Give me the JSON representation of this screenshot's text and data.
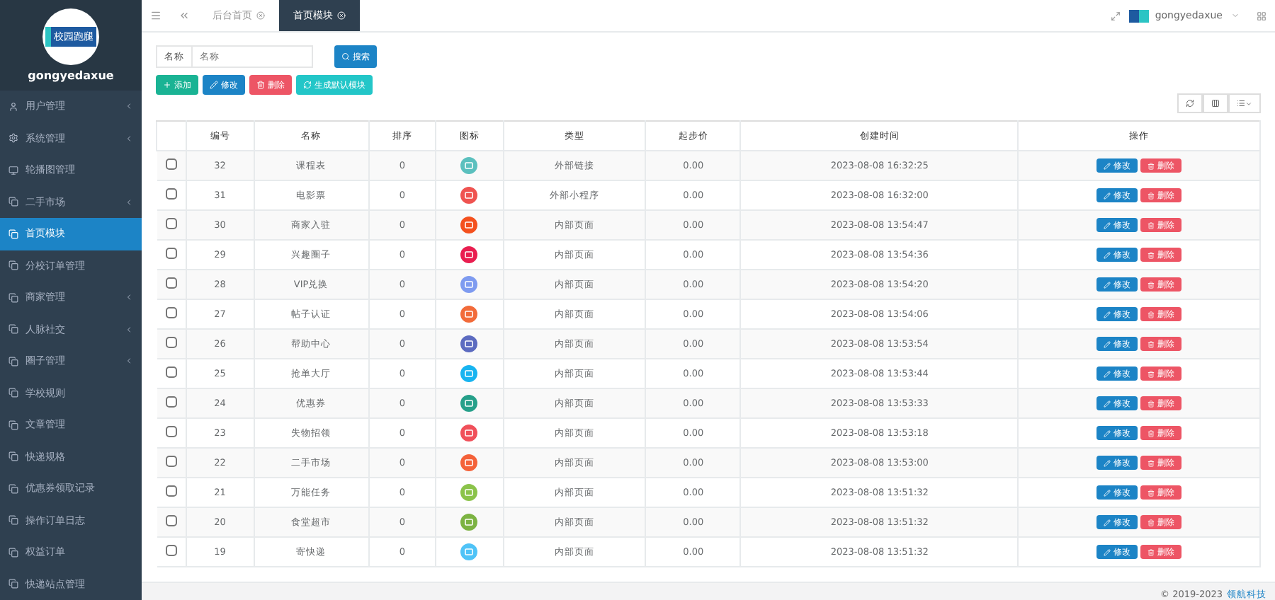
{
  "sidebar": {
    "username": "gongyedaxue",
    "logo_text": "校园跑腿",
    "items": [
      {
        "label": "用户管理",
        "selected": false,
        "expandable": true
      },
      {
        "label": "系统管理",
        "selected": false,
        "expandable": true
      },
      {
        "label": "轮播图管理",
        "selected": false,
        "expandable": false
      },
      {
        "label": "二手市场",
        "selected": false,
        "expandable": true
      },
      {
        "label": "首页模块",
        "selected": true,
        "expandable": false
      },
      {
        "label": "分校订单管理",
        "selected": false,
        "expandable": false
      },
      {
        "label": "商家管理",
        "selected": false,
        "expandable": true
      },
      {
        "label": "人脉社交",
        "selected": false,
        "expandable": true
      },
      {
        "label": "圈子管理",
        "selected": false,
        "expandable": true
      },
      {
        "label": "学校规则",
        "selected": false,
        "expandable": false
      },
      {
        "label": "文章管理",
        "selected": false,
        "expandable": false
      },
      {
        "label": "快递规格",
        "selected": false,
        "expandable": false
      },
      {
        "label": "优惠券领取记录",
        "selected": false,
        "expandable": false
      },
      {
        "label": "操作订单日志",
        "selected": false,
        "expandable": false
      },
      {
        "label": "权益订单",
        "selected": false,
        "expandable": false
      },
      {
        "label": "快递站点管理",
        "selected": false,
        "expandable": false
      }
    ]
  },
  "tabs": [
    {
      "label": "后台首页",
      "selected": false
    },
    {
      "label": "首页模块",
      "selected": true
    }
  ],
  "user_menu": {
    "name": "gongyedaxue"
  },
  "search": {
    "label": "名称",
    "placeholder": "名称",
    "button": "搜索"
  },
  "actions": [
    {
      "label": "添加",
      "kind": "add"
    },
    {
      "label": "修改",
      "kind": "edit"
    },
    {
      "label": "删除",
      "kind": "delete"
    },
    {
      "label": "生成默认模块",
      "kind": "generate"
    }
  ],
  "table": {
    "columns": [
      "编号",
      "名称",
      "排序",
      "图标",
      "类型",
      "起步价",
      "创建时间",
      "操作"
    ],
    "rows": [
      {
        "id": "32",
        "name": "课程表",
        "sort": "0",
        "color": "#5bc0be",
        "type": "外部链接",
        "price": "0.00",
        "created": "2023-08-08 16:32:25",
        "checked": false
      },
      {
        "id": "31",
        "name": "电影票",
        "sort": "0",
        "color": "#ef5350",
        "type": "外部小程序",
        "price": "0.00",
        "created": "2023-08-08 16:32:00",
        "checked": false
      },
      {
        "id": "30",
        "name": "商家入驻",
        "sort": "0",
        "color": "#f4511e",
        "type": "内部页面",
        "price": "0.00",
        "created": "2023-08-08 13:54:47",
        "checked": false
      },
      {
        "id": "29",
        "name": "兴趣圈子",
        "sort": "0",
        "color": "#e91e50",
        "type": "内部页面",
        "price": "0.00",
        "created": "2023-08-08 13:54:36",
        "checked": false
      },
      {
        "id": "28",
        "name": "VIP兑换",
        "sort": "0",
        "color": "#7e9bf0",
        "type": "内部页面",
        "price": "0.00",
        "created": "2023-08-08 13:54:20",
        "checked": false
      },
      {
        "id": "27",
        "name": "帖子认证",
        "sort": "0",
        "color": "#f26b3a",
        "type": "内部页面",
        "price": "0.00",
        "created": "2023-08-08 13:54:06",
        "checked": false
      },
      {
        "id": "26",
        "name": "帮助中心",
        "sort": "0",
        "color": "#5c6bc0",
        "type": "内部页面",
        "price": "0.00",
        "created": "2023-08-08 13:53:54",
        "checked": false
      },
      {
        "id": "25",
        "name": "抢单大厅",
        "sort": "0",
        "color": "#18b4f0",
        "type": "内部页面",
        "price": "0.00",
        "created": "2023-08-08 13:53:44",
        "checked": false
      },
      {
        "id": "24",
        "name": "优惠券",
        "sort": "0",
        "color": "#26a08a",
        "type": "内部页面",
        "price": "0.00",
        "created": "2023-08-08 13:53:33",
        "checked": false
      },
      {
        "id": "23",
        "name": "失物招领",
        "sort": "0",
        "color": "#f0505a",
        "type": "内部页面",
        "price": "0.00",
        "created": "2023-08-08 13:53:18",
        "checked": false
      },
      {
        "id": "22",
        "name": "二手市场",
        "sort": "0",
        "color": "#f4623a",
        "type": "内部页面",
        "price": "0.00",
        "created": "2023-08-08 13:53:00",
        "checked": false
      },
      {
        "id": "21",
        "name": "万能任务",
        "sort": "0",
        "color": "#8bc34a",
        "type": "内部页面",
        "price": "0.00",
        "created": "2023-08-08 13:51:32",
        "checked": false
      },
      {
        "id": "20",
        "name": "食堂超市",
        "sort": "0",
        "color": "#7cb342",
        "type": "内部页面",
        "price": "0.00",
        "created": "2023-08-08 13:51:32",
        "checked": false
      },
      {
        "id": "19",
        "name": "寄快递",
        "sort": "0",
        "color": "#4fc3f7",
        "type": "内部页面",
        "price": "0.00",
        "created": "2023-08-08 13:51:32",
        "checked": false
      }
    ],
    "row_edit": [
      "修改",
      "修改",
      "修改",
      "修改",
      "修改",
      "修改",
      "修改",
      "修改",
      "修改",
      "修改",
      "修改",
      "修改",
      "修改",
      "修改"
    ],
    "row_delete": [
      "删除",
      "删除",
      "删除",
      "删除",
      "删除",
      "删除",
      "删除",
      "删除",
      "删除",
      "删除",
      "删除",
      "删除",
      "删除",
      "删除"
    ]
  },
  "footer": {
    "text": "© 2019-2023",
    "link": "领航科技"
  }
}
